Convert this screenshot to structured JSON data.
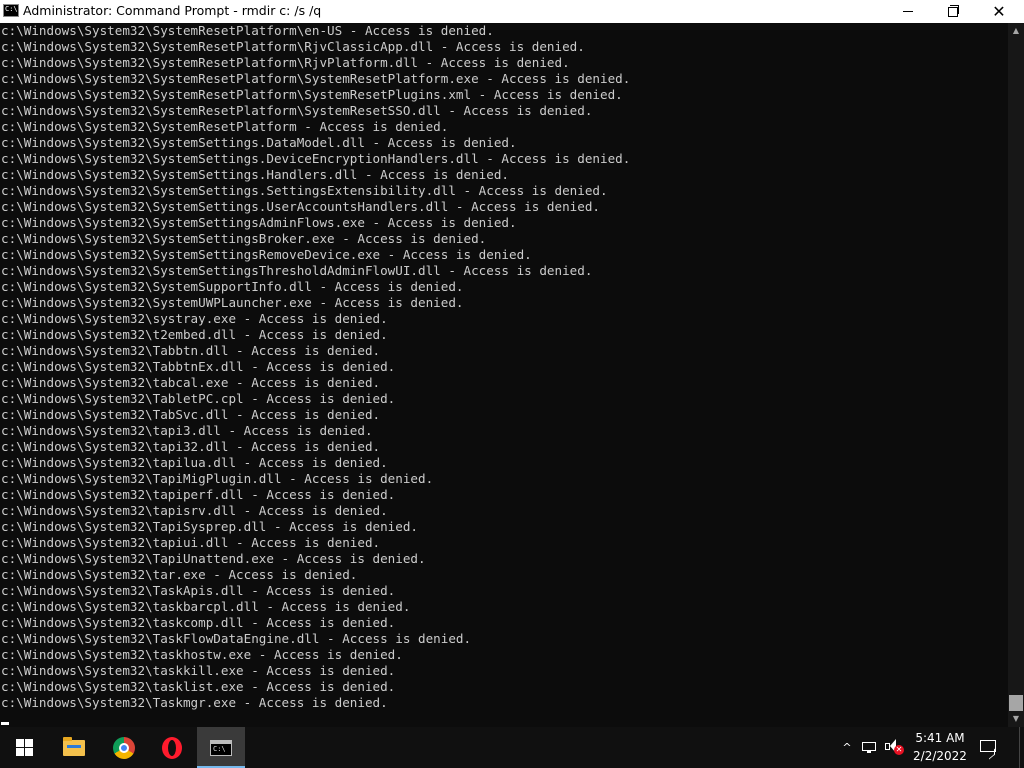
{
  "window": {
    "title": "Administrator: Command Prompt - rmdir  c: /s /q",
    "icon_text": "C:\\",
    "controls": [
      "minimize-icon",
      "maximize-icon",
      "close-icon"
    ]
  },
  "console": {
    "lines": [
      "c:\\Windows\\System32\\SystemResetPlatform\\en-US - Access is denied.",
      "c:\\Windows\\System32\\SystemResetPlatform\\RjvClassicApp.dll - Access is denied.",
      "c:\\Windows\\System32\\SystemResetPlatform\\RjvPlatform.dll - Access is denied.",
      "c:\\Windows\\System32\\SystemResetPlatform\\SystemResetPlatform.exe - Access is denied.",
      "c:\\Windows\\System32\\SystemResetPlatform\\SystemResetPlugins.xml - Access is denied.",
      "c:\\Windows\\System32\\SystemResetPlatform\\SystemResetSSO.dll - Access is denied.",
      "c:\\Windows\\System32\\SystemResetPlatform - Access is denied.",
      "c:\\Windows\\System32\\SystemSettings.DataModel.dll - Access is denied.",
      "c:\\Windows\\System32\\SystemSettings.DeviceEncryptionHandlers.dll - Access is denied.",
      "c:\\Windows\\System32\\SystemSettings.Handlers.dll - Access is denied.",
      "c:\\Windows\\System32\\SystemSettings.SettingsExtensibility.dll - Access is denied.",
      "c:\\Windows\\System32\\SystemSettings.UserAccountsHandlers.dll - Access is denied.",
      "c:\\Windows\\System32\\SystemSettingsAdminFlows.exe - Access is denied.",
      "c:\\Windows\\System32\\SystemSettingsBroker.exe - Access is denied.",
      "c:\\Windows\\System32\\SystemSettingsRemoveDevice.exe - Access is denied.",
      "c:\\Windows\\System32\\SystemSettingsThresholdAdminFlowUI.dll - Access is denied.",
      "c:\\Windows\\System32\\SystemSupportInfo.dll - Access is denied.",
      "c:\\Windows\\System32\\SystemUWPLauncher.exe - Access is denied.",
      "c:\\Windows\\System32\\systray.exe - Access is denied.",
      "c:\\Windows\\System32\\t2embed.dll - Access is denied.",
      "c:\\Windows\\System32\\Tabbtn.dll - Access is denied.",
      "c:\\Windows\\System32\\TabbtnEx.dll - Access is denied.",
      "c:\\Windows\\System32\\tabcal.exe - Access is denied.",
      "c:\\Windows\\System32\\TabletPC.cpl - Access is denied.",
      "c:\\Windows\\System32\\TabSvc.dll - Access is denied.",
      "c:\\Windows\\System32\\tapi3.dll - Access is denied.",
      "c:\\Windows\\System32\\tapi32.dll - Access is denied.",
      "c:\\Windows\\System32\\tapilua.dll - Access is denied.",
      "c:\\Windows\\System32\\TapiMigPlugin.dll - Access is denied.",
      "c:\\Windows\\System32\\tapiperf.dll - Access is denied.",
      "c:\\Windows\\System32\\tapisrv.dll - Access is denied.",
      "c:\\Windows\\System32\\TapiSysprep.dll - Access is denied.",
      "c:\\Windows\\System32\\tapiui.dll - Access is denied.",
      "c:\\Windows\\System32\\TapiUnattend.exe - Access is denied.",
      "c:\\Windows\\System32\\tar.exe - Access is denied.",
      "c:\\Windows\\System32\\TaskApis.dll - Access is denied.",
      "c:\\Windows\\System32\\taskbarcpl.dll - Access is denied.",
      "c:\\Windows\\System32\\taskcomp.dll - Access is denied.",
      "c:\\Windows\\System32\\TaskFlowDataEngine.dll - Access is denied.",
      "c:\\Windows\\System32\\taskhostw.exe - Access is denied.",
      "c:\\Windows\\System32\\taskkill.exe - Access is denied.",
      "c:\\Windows\\System32\\tasklist.exe - Access is denied.",
      "c:\\Windows\\System32\\Taskmgr.exe - Access is denied."
    ],
    "colors": {
      "background": "#0c0c0c",
      "text": "#cccccc"
    }
  },
  "taskbar": {
    "apps": [
      {
        "name": "start",
        "icon": "windows-logo-icon"
      },
      {
        "name": "file-explorer",
        "icon": "folder-icon"
      },
      {
        "name": "chrome",
        "icon": "chrome-icon"
      },
      {
        "name": "opera",
        "icon": "opera-icon"
      },
      {
        "name": "command-prompt",
        "icon": "cmd-icon",
        "active": true
      }
    ],
    "tray": {
      "chevron": "^",
      "time": "5:41 AM",
      "date": "2/2/2022",
      "icons": [
        "network-icon",
        "volume-muted-icon",
        "notification-icon"
      ]
    },
    "accent": "#76b9ed"
  }
}
